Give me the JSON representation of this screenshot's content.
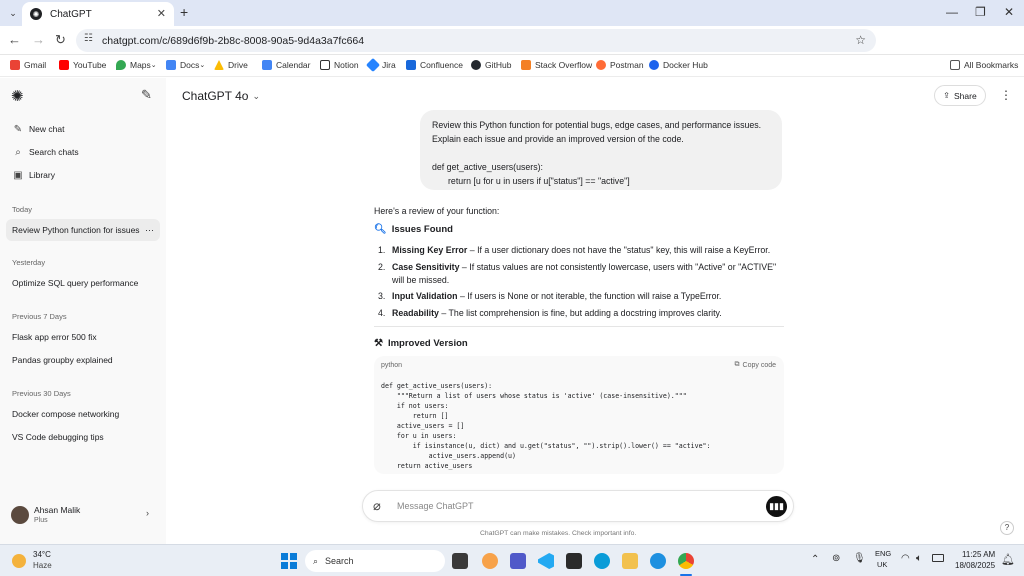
{
  "browser": {
    "tab_title": "ChatGPT",
    "url": "chatgpt.com/c/689d6f9b-2b8c-8008-90a5-9d4a3a7fc664",
    "bookmarks": [
      "Gmail",
      "YouTube",
      "Maps",
      "Docs",
      "Drive",
      "Calendar",
      "Notion",
      "Jira",
      "Confluence",
      "GitHub",
      "Stack Overflow",
      "Postman",
      "Docker Hub"
    ],
    "all_bookmarks": "All Bookmarks",
    "colors": {
      "tabbar": "#dfe6f5",
      "accent": "#1a73e8"
    }
  },
  "sidebar": {
    "new_chat": "New chat",
    "search": "Search chats",
    "library": "Library",
    "sections": [
      {
        "heading": "Today",
        "items": [
          "Review Python function for issues"
        ]
      },
      {
        "heading": "Yesterday",
        "items": [
          "Optimize SQL query performance"
        ]
      },
      {
        "heading": "Previous 7 Days",
        "items": [
          "Flask app error 500 fix",
          "Pandas groupby explained"
        ]
      },
      {
        "heading": "Previous 30 Days",
        "items": [
          "Docker compose networking",
          "VS Code debugging tips"
        ]
      }
    ],
    "more": "···",
    "user": {
      "name": "Ahsan Malik",
      "plan": "Plus"
    }
  },
  "header": {
    "model": "ChatGPT 4o",
    "share": "Share"
  },
  "conversation": {
    "user_message": {
      "line1": "Review this Python function for potential bugs, edge cases, and performance issues.",
      "line2": "Explain each issue and provide an improved version of the code.",
      "code1": "def get_active_users(users):",
      "code2": "return [u for u in users if u[\"status\"] == \"active\"]"
    },
    "intro": "Here's a review of your function:",
    "issues_heading": "Issues Found",
    "issues": [
      {
        "num": "1.",
        "title": "Missing Key Error",
        "text": " – If a user dictionary does not have the \"status\" key, this will raise a KeyError."
      },
      {
        "num": "2.",
        "title": "Case Sensitivity",
        "text": " – If status values are not consistently lowercase, users with \"Active\" or \"ACTIVE\"",
        "text2": "will be missed."
      },
      {
        "num": "3.",
        "title": "Input Validation",
        "text": " – If users is None or not iterable, the function will raise a TypeError."
      },
      {
        "num": "4.",
        "title": "Readability",
        "text": " – The list comprehension is fine, but adding a docstring improves clarity."
      }
    ],
    "improved_heading": "Improved Version",
    "code_lang": "python",
    "copy_label": "Copy code",
    "code_lines": [
      "def get_active_users(users):",
      "    \"\"\"Return a list of users whose status is 'active' (case-insensitive).\"\"\"",
      "    if not users:",
      "        return []",
      "    active_users = []",
      "    for u in users:",
      "        if isinstance(u, dict) and u.get(\"status\", \"\").strip().lower() == \"active\":",
      "            active_users.append(u)",
      "    return active_users"
    ]
  },
  "composer": {
    "placeholder": "Message ChatGPT",
    "disclaimer": "ChatGPT can make mistakes. Check important info.",
    "help": "?"
  },
  "taskbar": {
    "weather_temp": "34°C",
    "weather_desc": "Haze",
    "search": "Search",
    "lang1": "ENG",
    "lang2": "UK",
    "time": "11:25 AM",
    "date": "18/08/2025"
  }
}
